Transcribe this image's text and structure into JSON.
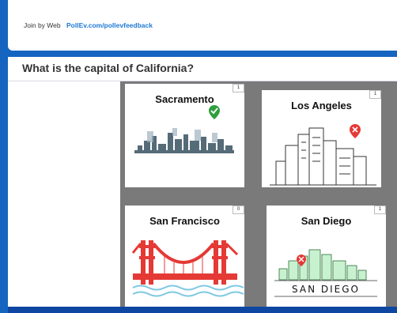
{
  "header": {
    "join_label": "Join by Web",
    "join_url": "PollEv.com/pollevfeedback"
  },
  "question": {
    "text": "What is the capital of California?"
  },
  "options": [
    {
      "label": "Sacramento",
      "votes": "1",
      "marker": "check-pin-icon",
      "marker_color": "#2e9e3f"
    },
    {
      "label": "Los Angeles",
      "votes": "1",
      "marker": "x-pin-icon",
      "marker_color": "#e53935"
    },
    {
      "label": "San Francisco",
      "votes": "0"
    },
    {
      "label": "San Diego",
      "votes": "1",
      "marker": "x-pin-icon",
      "marker_color": "#e53935",
      "sign_text": "SAN DIEGO"
    }
  ],
  "colors": {
    "background": "#1565c0",
    "link": "#1e78d6",
    "grid": "#7a7a7a",
    "bridge": "#e53935"
  }
}
